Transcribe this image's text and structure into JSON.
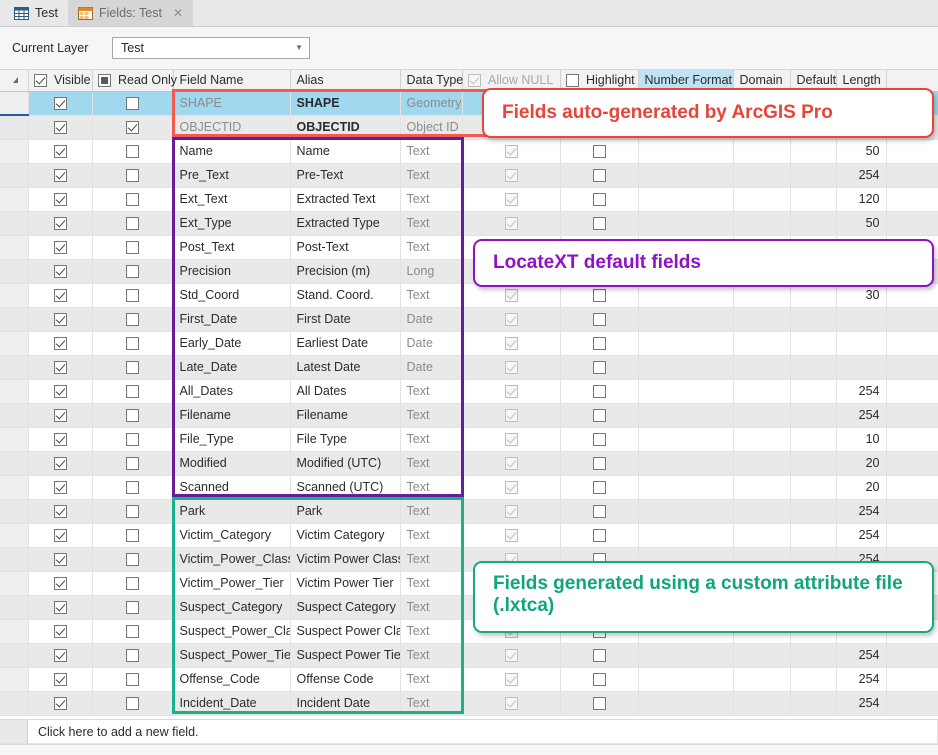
{
  "window": {
    "tabs": [
      {
        "label": "Test",
        "icon": "table-grid-icon",
        "active": false,
        "closable": false
      },
      {
        "label": "Fields:  Test",
        "icon": "fields-table-icon",
        "active": true,
        "closable": true,
        "close_glyph": "✕"
      }
    ]
  },
  "layer_bar": {
    "label": "Current Layer",
    "value": "Test",
    "caret": "▼"
  },
  "grid": {
    "columns": [
      {
        "key": "rowhdr",
        "label": "",
        "type": "corner"
      },
      {
        "key": "visible",
        "label": "Visible",
        "type": "checkbox-header",
        "checked": true
      },
      {
        "key": "readonly",
        "label": "Read Only",
        "type": "checkbox-header",
        "state": "partial"
      },
      {
        "key": "field_name",
        "label": "Field Name",
        "type": "text"
      },
      {
        "key": "alias",
        "label": "Alias",
        "type": "text"
      },
      {
        "key": "data_type",
        "label": "Data Type",
        "type": "text"
      },
      {
        "key": "allow_null",
        "label": "Allow NULL",
        "type": "checkbox-header",
        "checked": true,
        "disabled": true
      },
      {
        "key": "highlight",
        "label": "Highlight",
        "type": "checkbox-header",
        "checked": false
      },
      {
        "key": "number_format",
        "label": "Number Format",
        "type": "text",
        "highlighted": true
      },
      {
        "key": "domain",
        "label": "Domain",
        "type": "text"
      },
      {
        "key": "default",
        "label": "Default",
        "type": "text"
      },
      {
        "key": "length",
        "label": "Length",
        "type": "number"
      }
    ],
    "rows": [
      {
        "visible": true,
        "read_only": false,
        "field_name": "SHAPE",
        "alias": "SHAPE",
        "data_type": "Geometry",
        "allow_null": true,
        "highlight": false,
        "length": "",
        "selected": true,
        "alias_bold": true,
        "name_grey": true
      },
      {
        "visible": true,
        "read_only": true,
        "field_name": "OBJECTID",
        "alias": "OBJECTID",
        "data_type": "Object ID",
        "allow_null": false,
        "highlight": false,
        "length": "",
        "alias_bold": true,
        "name_grey": true
      },
      {
        "visible": true,
        "read_only": false,
        "field_name": "Name",
        "alias": "Name",
        "data_type": "Text",
        "allow_null": true,
        "highlight": false,
        "length": "50"
      },
      {
        "visible": true,
        "read_only": false,
        "field_name": "Pre_Text",
        "alias": "Pre-Text",
        "data_type": "Text",
        "allow_null": true,
        "highlight": false,
        "length": "254"
      },
      {
        "visible": true,
        "read_only": false,
        "field_name": "Ext_Text",
        "alias": "Extracted Text",
        "data_type": "Text",
        "allow_null": true,
        "highlight": false,
        "length": "120"
      },
      {
        "visible": true,
        "read_only": false,
        "field_name": "Ext_Type",
        "alias": "Extracted Type",
        "data_type": "Text",
        "allow_null": true,
        "highlight": false,
        "length": "50"
      },
      {
        "visible": true,
        "read_only": false,
        "field_name": "Post_Text",
        "alias": "Post-Text",
        "data_type": "Text",
        "allow_null": true,
        "highlight": false,
        "length": ""
      },
      {
        "visible": true,
        "read_only": false,
        "field_name": "Precision",
        "alias": "Precision (m)",
        "data_type": "Long",
        "allow_null": true,
        "highlight": false,
        "length": ""
      },
      {
        "visible": true,
        "read_only": false,
        "field_name": "Std_Coord",
        "alias": "Stand. Coord.",
        "data_type": "Text",
        "allow_null": true,
        "highlight": false,
        "length": "30"
      },
      {
        "visible": true,
        "read_only": false,
        "field_name": "First_Date",
        "alias": "First Date",
        "data_type": "Date",
        "allow_null": true,
        "highlight": false,
        "length": ""
      },
      {
        "visible": true,
        "read_only": false,
        "field_name": "Early_Date",
        "alias": "Earliest Date",
        "data_type": "Date",
        "allow_null": true,
        "highlight": false,
        "length": ""
      },
      {
        "visible": true,
        "read_only": false,
        "field_name": "Late_Date",
        "alias": "Latest Date",
        "data_type": "Date",
        "allow_null": true,
        "highlight": false,
        "length": ""
      },
      {
        "visible": true,
        "read_only": false,
        "field_name": "All_Dates",
        "alias": "All Dates",
        "data_type": "Text",
        "allow_null": true,
        "highlight": false,
        "length": "254"
      },
      {
        "visible": true,
        "read_only": false,
        "field_name": "Filename",
        "alias": "Filename",
        "data_type": "Text",
        "allow_null": true,
        "highlight": false,
        "length": "254"
      },
      {
        "visible": true,
        "read_only": false,
        "field_name": "File_Type",
        "alias": "File Type",
        "data_type": "Text",
        "allow_null": true,
        "highlight": false,
        "length": "10"
      },
      {
        "visible": true,
        "read_only": false,
        "field_name": "Modified",
        "alias": "Modified (UTC)",
        "data_type": "Text",
        "allow_null": true,
        "highlight": false,
        "length": "20"
      },
      {
        "visible": true,
        "read_only": false,
        "field_name": "Scanned",
        "alias": "Scanned (UTC)",
        "data_type": "Text",
        "allow_null": true,
        "highlight": false,
        "length": "20"
      },
      {
        "visible": true,
        "read_only": false,
        "field_name": "Park",
        "alias": "Park",
        "data_type": "Text",
        "allow_null": true,
        "highlight": false,
        "length": "254"
      },
      {
        "visible": true,
        "read_only": false,
        "field_name": "Victim_Category",
        "alias": "Victim Category",
        "data_type": "Text",
        "allow_null": true,
        "highlight": false,
        "length": "254"
      },
      {
        "visible": true,
        "read_only": false,
        "field_name": "Victim_Power_Class",
        "alias": "Victim Power Class",
        "data_type": "Text",
        "allow_null": true,
        "highlight": false,
        "length": "254"
      },
      {
        "visible": true,
        "read_only": false,
        "field_name": "Victim_Power_Tier",
        "alias": "Victim Power Tier",
        "data_type": "Text",
        "allow_null": true,
        "highlight": false,
        "length": ""
      },
      {
        "visible": true,
        "read_only": false,
        "field_name": "Suspect_Category",
        "alias": "Suspect Category",
        "data_type": "Text",
        "allow_null": true,
        "highlight": false,
        "length": ""
      },
      {
        "visible": true,
        "read_only": false,
        "field_name": "Suspect_Power_Class",
        "alias": "Suspect Power Class",
        "data_type": "Text",
        "allow_null": true,
        "highlight": false,
        "length": ""
      },
      {
        "visible": true,
        "read_only": false,
        "field_name": "Suspect_Power_Tier",
        "alias": "Suspect Power Tier",
        "data_type": "Text",
        "allow_null": true,
        "highlight": false,
        "length": "254"
      },
      {
        "visible": true,
        "read_only": false,
        "field_name": "Offense_Code",
        "alias": "Offense Code",
        "data_type": "Text",
        "allow_null": true,
        "highlight": false,
        "length": "254"
      },
      {
        "visible": true,
        "read_only": false,
        "field_name": "Incident_Date",
        "alias": "Incident Date",
        "data_type": "Text",
        "allow_null": true,
        "highlight": false,
        "length": "254"
      }
    ]
  },
  "footer": {
    "add_field_text": "Click here to add a new field."
  },
  "annotations": [
    {
      "id": "arcgis",
      "text": "Fields auto-generated by ArcGIS Pro",
      "color": "#e8443a"
    },
    {
      "id": "locatext",
      "text": "LocateXT default fields",
      "color": "#8f12c9"
    },
    {
      "id": "custom",
      "text": "Fields generated using a custom attribute file (.lxtca)",
      "color": "#11a57e"
    }
  ]
}
